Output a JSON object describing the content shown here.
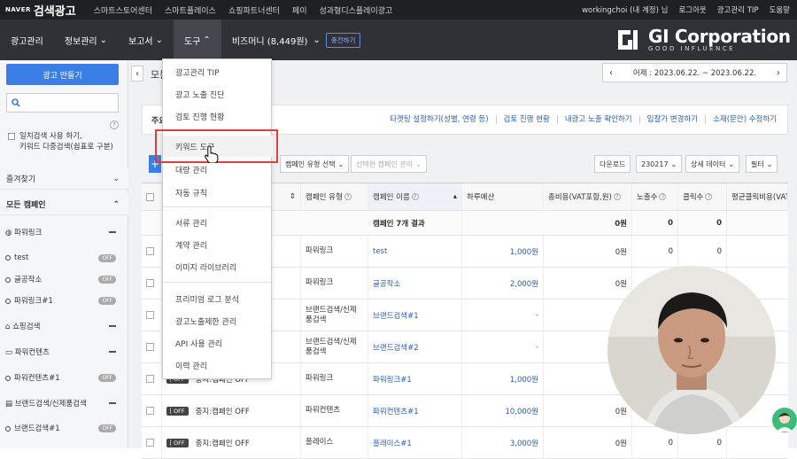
{
  "topbar": {
    "naver": "NAVER",
    "brand": "검색광고",
    "nav": [
      "스마트스토어센터",
      "스마트플레이스",
      "쇼핑파트너센터",
      "페이",
      "성과형디스플레이광고"
    ],
    "right": [
      "workingchoi (내 계정) 님",
      "로그아웃",
      "광고관리 TIP",
      "도움말"
    ]
  },
  "navbar": {
    "items": [
      "광고관리",
      "정보관리",
      "보고서",
      "도구"
    ],
    "bizmoney": "비즈머니 (8,449원)",
    "charge": "충전하기"
  },
  "watermark": {
    "name": "GI Corporation",
    "tagline": "GOOD INFLUENCE"
  },
  "sidebar": {
    "make_button": "광고 만들기",
    "exact_match_line1": "일치검색 사용 하기,",
    "exact_match_line2": "키워드 다중검색(쉼표로 구분)",
    "favorites": "즐겨찾기",
    "all_campaigns": "모든 캠페인",
    "groups": [
      {
        "type": "파워링크",
        "items": [
          "test",
          "글공작소",
          "파워링크#1"
        ]
      },
      {
        "type": "쇼핑검색",
        "items": []
      },
      {
        "type": "파워컨텐츠",
        "items": [
          "파워컨텐츠#1"
        ]
      },
      {
        "type": "브랜드검색/신제품검색",
        "items": [
          "브랜드검색#1"
        ]
      }
    ],
    "off": "OFF"
  },
  "main": {
    "title_fragment": "모든",
    "date_range": "어제 : 2023.06.22. ~ 2023.06.22.",
    "links_label": "주요",
    "links": [
      "타겟팅 설정하기(성별, 연령 등)",
      "검토 진행 현황",
      "내광고 노출 확인하기",
      "입찰가 변경하기",
      "소재(문안) 수정하기"
    ],
    "toolbar": {
      "campaign_type": "캠페인 유형 선택",
      "selected_manage": "선택한 캠페인 관리",
      "download": "다운로드",
      "code": "230217",
      "detail_data": "상세 데이터",
      "filter": "필터"
    }
  },
  "table": {
    "headers": [
      "캠페인 유형",
      "캠페인 이름",
      "하루예산",
      "총비용(VAT포함,원)",
      "노출수",
      "클릭수",
      "평균클릭비용(VAT포"
    ],
    "summary": {
      "name": "캠페인 7개 결과",
      "cost": "0원",
      "impressions": "0",
      "clicks": "0"
    },
    "rows": [
      {
        "status": "OFF",
        "type": "파워링크",
        "name": "test",
        "budget": "1,000원",
        "cost": "0원",
        "impressions": "0",
        "clicks": "0"
      },
      {
        "status": "OFF",
        "type": "파워링크",
        "name": "글공작소",
        "budget": "2,000원",
        "cost": "0원",
        "impressions": "0",
        "clicks": "0"
      },
      {
        "status": "OFF",
        "type": "브랜드검색/신제품검색",
        "name": "브랜드검색#1",
        "budget": "-",
        "cost": "0원",
        "impressions": "0",
        "clicks": "0"
      },
      {
        "status": "OFF",
        "type": "브랜드검색/신제품검색",
        "name": "브랜드검색#2",
        "budget": "-",
        "cost": "0원",
        "impressions": "0",
        "clicks": "0"
      },
      {
        "status": "중지:캠페인 OFF",
        "type": "파워링크",
        "name": "파워링크#1",
        "budget": "1,000원",
        "cost": "0원",
        "impressions": "0",
        "clicks": "0"
      },
      {
        "status": "중지:캠페인 OFF",
        "type": "파워컨텐츠",
        "name": "파워컨텐츠#1",
        "budget": "10,000원",
        "cost": "0원",
        "impressions": "0",
        "clicks": "0"
      },
      {
        "status": "중지:캠페인 OFF",
        "type": "플레이스",
        "name": "플레이스#1",
        "budget": "3,000원",
        "cost": "0원",
        "impressions": "0",
        "clicks": "0"
      }
    ]
  },
  "dropdown": {
    "groups": [
      [
        "광고관리 TIP",
        "광고 노출 진단",
        "검토 진행 현황"
      ],
      [
        "키워드 도구",
        "대량 관리",
        "자동 규칙"
      ],
      [
        "서류 관리",
        "계약 관리",
        "이미지 라이브러리"
      ],
      [
        "프리미엄 로그 분석",
        "광고노출제한 관리",
        "API 사용 관리",
        "이력 관리"
      ]
    ],
    "highlighted": "키워드 도구"
  }
}
